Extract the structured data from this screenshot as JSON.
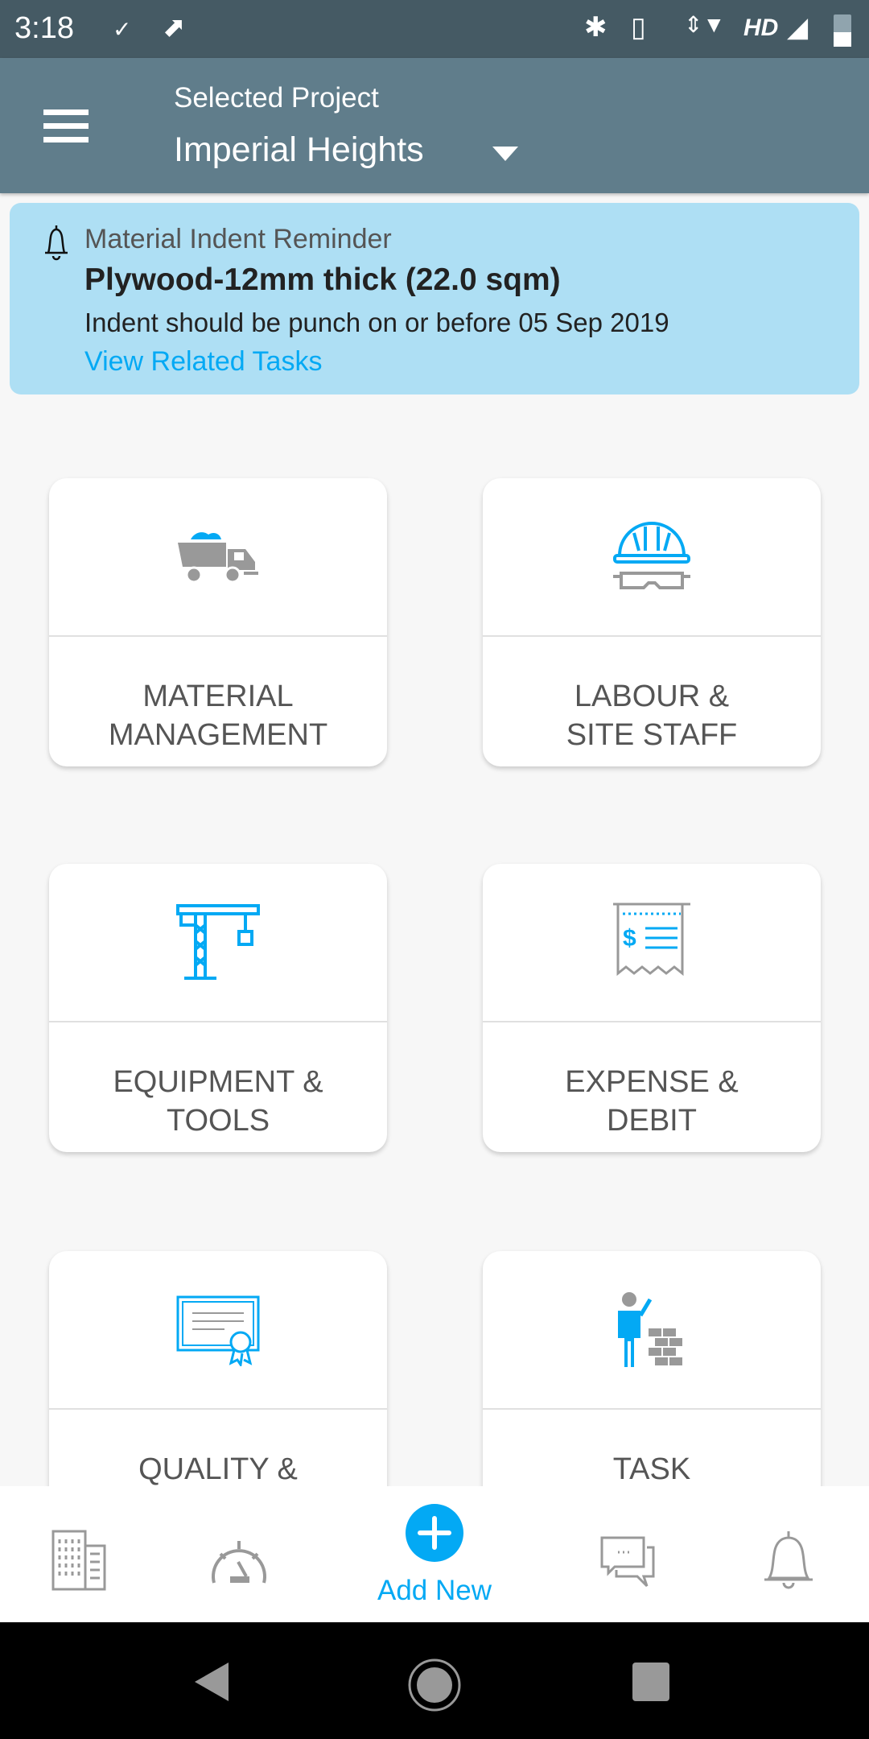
{
  "status_bar": {
    "time": "3:18",
    "network": "HD"
  },
  "header": {
    "label": "Selected Project",
    "project": "Imperial Heights"
  },
  "reminder": {
    "title": "Material Indent Reminder",
    "item": "Plywood-12mm thick (22.0 sqm)",
    "message": "Indent should be punch on or before 05 Sep 2019",
    "link": "View Related Tasks"
  },
  "modules": [
    {
      "line1": "MATERIAL",
      "line2": "MANAGEMENT",
      "icon": "dump-truck-icon"
    },
    {
      "line1": "LABOUR &",
      "line2": "SITE STAFF",
      "icon": "hard-hat-goggles-icon"
    },
    {
      "line1": "EQUIPMENT &",
      "line2": "TOOLS",
      "icon": "crane-icon"
    },
    {
      "line1": "EXPENSE &",
      "line2": "DEBIT",
      "icon": "receipt-icon"
    },
    {
      "line1": "QUALITY &",
      "line2": "",
      "icon": "certificate-icon"
    },
    {
      "line1": "TASK",
      "line2": "",
      "icon": "worker-bricks-icon"
    }
  ],
  "bottom_nav": {
    "add_label": "Add New"
  },
  "colors": {
    "status": "#455a64",
    "header": "#607d8b",
    "banner": "#aedff4",
    "accent": "#03a9f4"
  }
}
